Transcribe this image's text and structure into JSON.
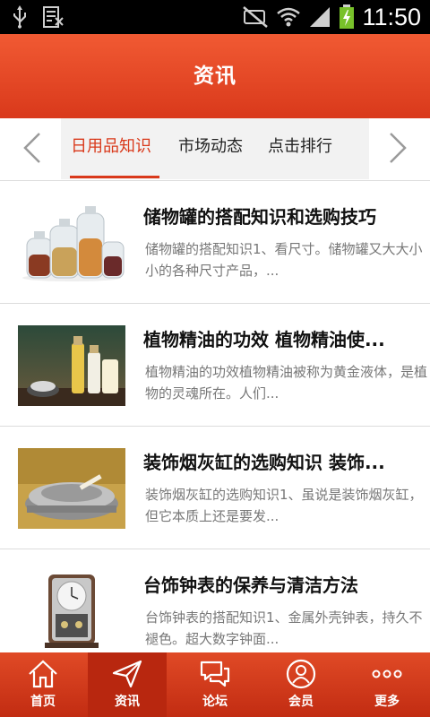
{
  "status_bar": {
    "time": "11:50",
    "icons": [
      "usb-icon",
      "notification-icon",
      "mute-icon",
      "wifi-icon",
      "signal-icon",
      "battery-icon"
    ]
  },
  "header": {
    "title": "资讯"
  },
  "tabs": [
    {
      "label": "日用品知识",
      "active": true
    },
    {
      "label": "市场动态",
      "active": false
    },
    {
      "label": "点击排行",
      "active": false
    }
  ],
  "articles": [
    {
      "title": "储物罐的搭配知识和选购技巧",
      "desc": "储物罐的搭配知识1、看尺寸。储物罐又大大小小的各种尺寸产品，...",
      "thumb": "storage-jars"
    },
    {
      "title": "植物精油的功效 植物精油使...",
      "desc": "植物精油的功效植物精油被称为黄金液体，是植物的灵魂所在。人们...",
      "thumb": "essential-oils"
    },
    {
      "title": "装饰烟灰缸的选购知识 装饰...",
      "desc": "装饰烟灰缸的选购知识1、虽说是装饰烟灰缸，但它本质上还是要发...",
      "thumb": "ashtray"
    },
    {
      "title": "台饰钟表的保养与清洁方法",
      "desc": "台饰钟表的搭配知识1、金属外壳钟表，持久不褪色。超大数字钟面...",
      "thumb": "table-clock"
    }
  ],
  "bottom_nav": [
    {
      "label": "首页",
      "icon": "home-icon",
      "active": false
    },
    {
      "label": "资讯",
      "icon": "send-icon",
      "active": true
    },
    {
      "label": "论坛",
      "icon": "chat-icon",
      "active": false
    },
    {
      "label": "会员",
      "icon": "user-icon",
      "active": false
    },
    {
      "label": "更多",
      "icon": "more-icon",
      "active": false
    }
  ],
  "colors": {
    "accent": "#d9391b",
    "header": "#f15a33",
    "text_dark": "#111111",
    "text_muted": "#777777"
  }
}
